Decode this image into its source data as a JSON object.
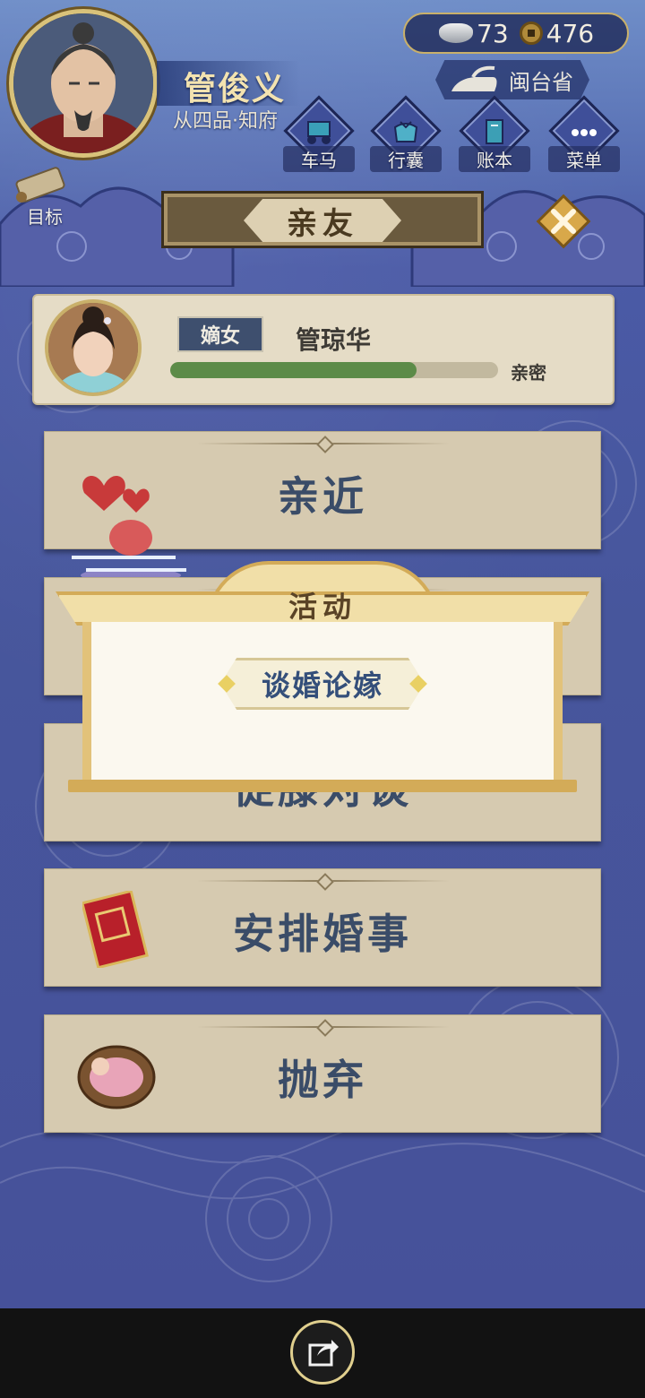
{
  "player": {
    "name": "管俊义",
    "rank": "从四品·知府"
  },
  "resources": {
    "silver": "73",
    "coins": "476"
  },
  "location": "闽台省",
  "top_buttons": [
    {
      "label": "车马",
      "icon": "carriage-icon"
    },
    {
      "label": "行囊",
      "icon": "bundle-icon"
    },
    {
      "label": "账本",
      "icon": "ledger-icon"
    },
    {
      "label": "菜单",
      "icon": "more-icon"
    }
  ],
  "goal_label": "目标",
  "page_title": "亲友",
  "relative": {
    "relation": "嫡女",
    "name": "管琼华",
    "intimacy_label": "亲密",
    "intimacy_level": 0.75
  },
  "actions": [
    {
      "label": "亲近",
      "icon": "hearts-umbrella-icon"
    },
    {
      "label": "",
      "icon": ""
    },
    {
      "label": "促膝对谈",
      "icon": ""
    },
    {
      "label": "安排婚事",
      "icon": "red-marriage-book-icon"
    },
    {
      "label": "抛弃",
      "icon": "baby-basket-icon"
    }
  ],
  "popup": {
    "title": "活动",
    "option": "谈婚论嫁"
  },
  "colors": {
    "background": "#47569c",
    "card": "#d6cab0",
    "accent_gold": "#d3ab58",
    "text_blue": "#344f7a",
    "bar_green": "#5c8b48"
  }
}
